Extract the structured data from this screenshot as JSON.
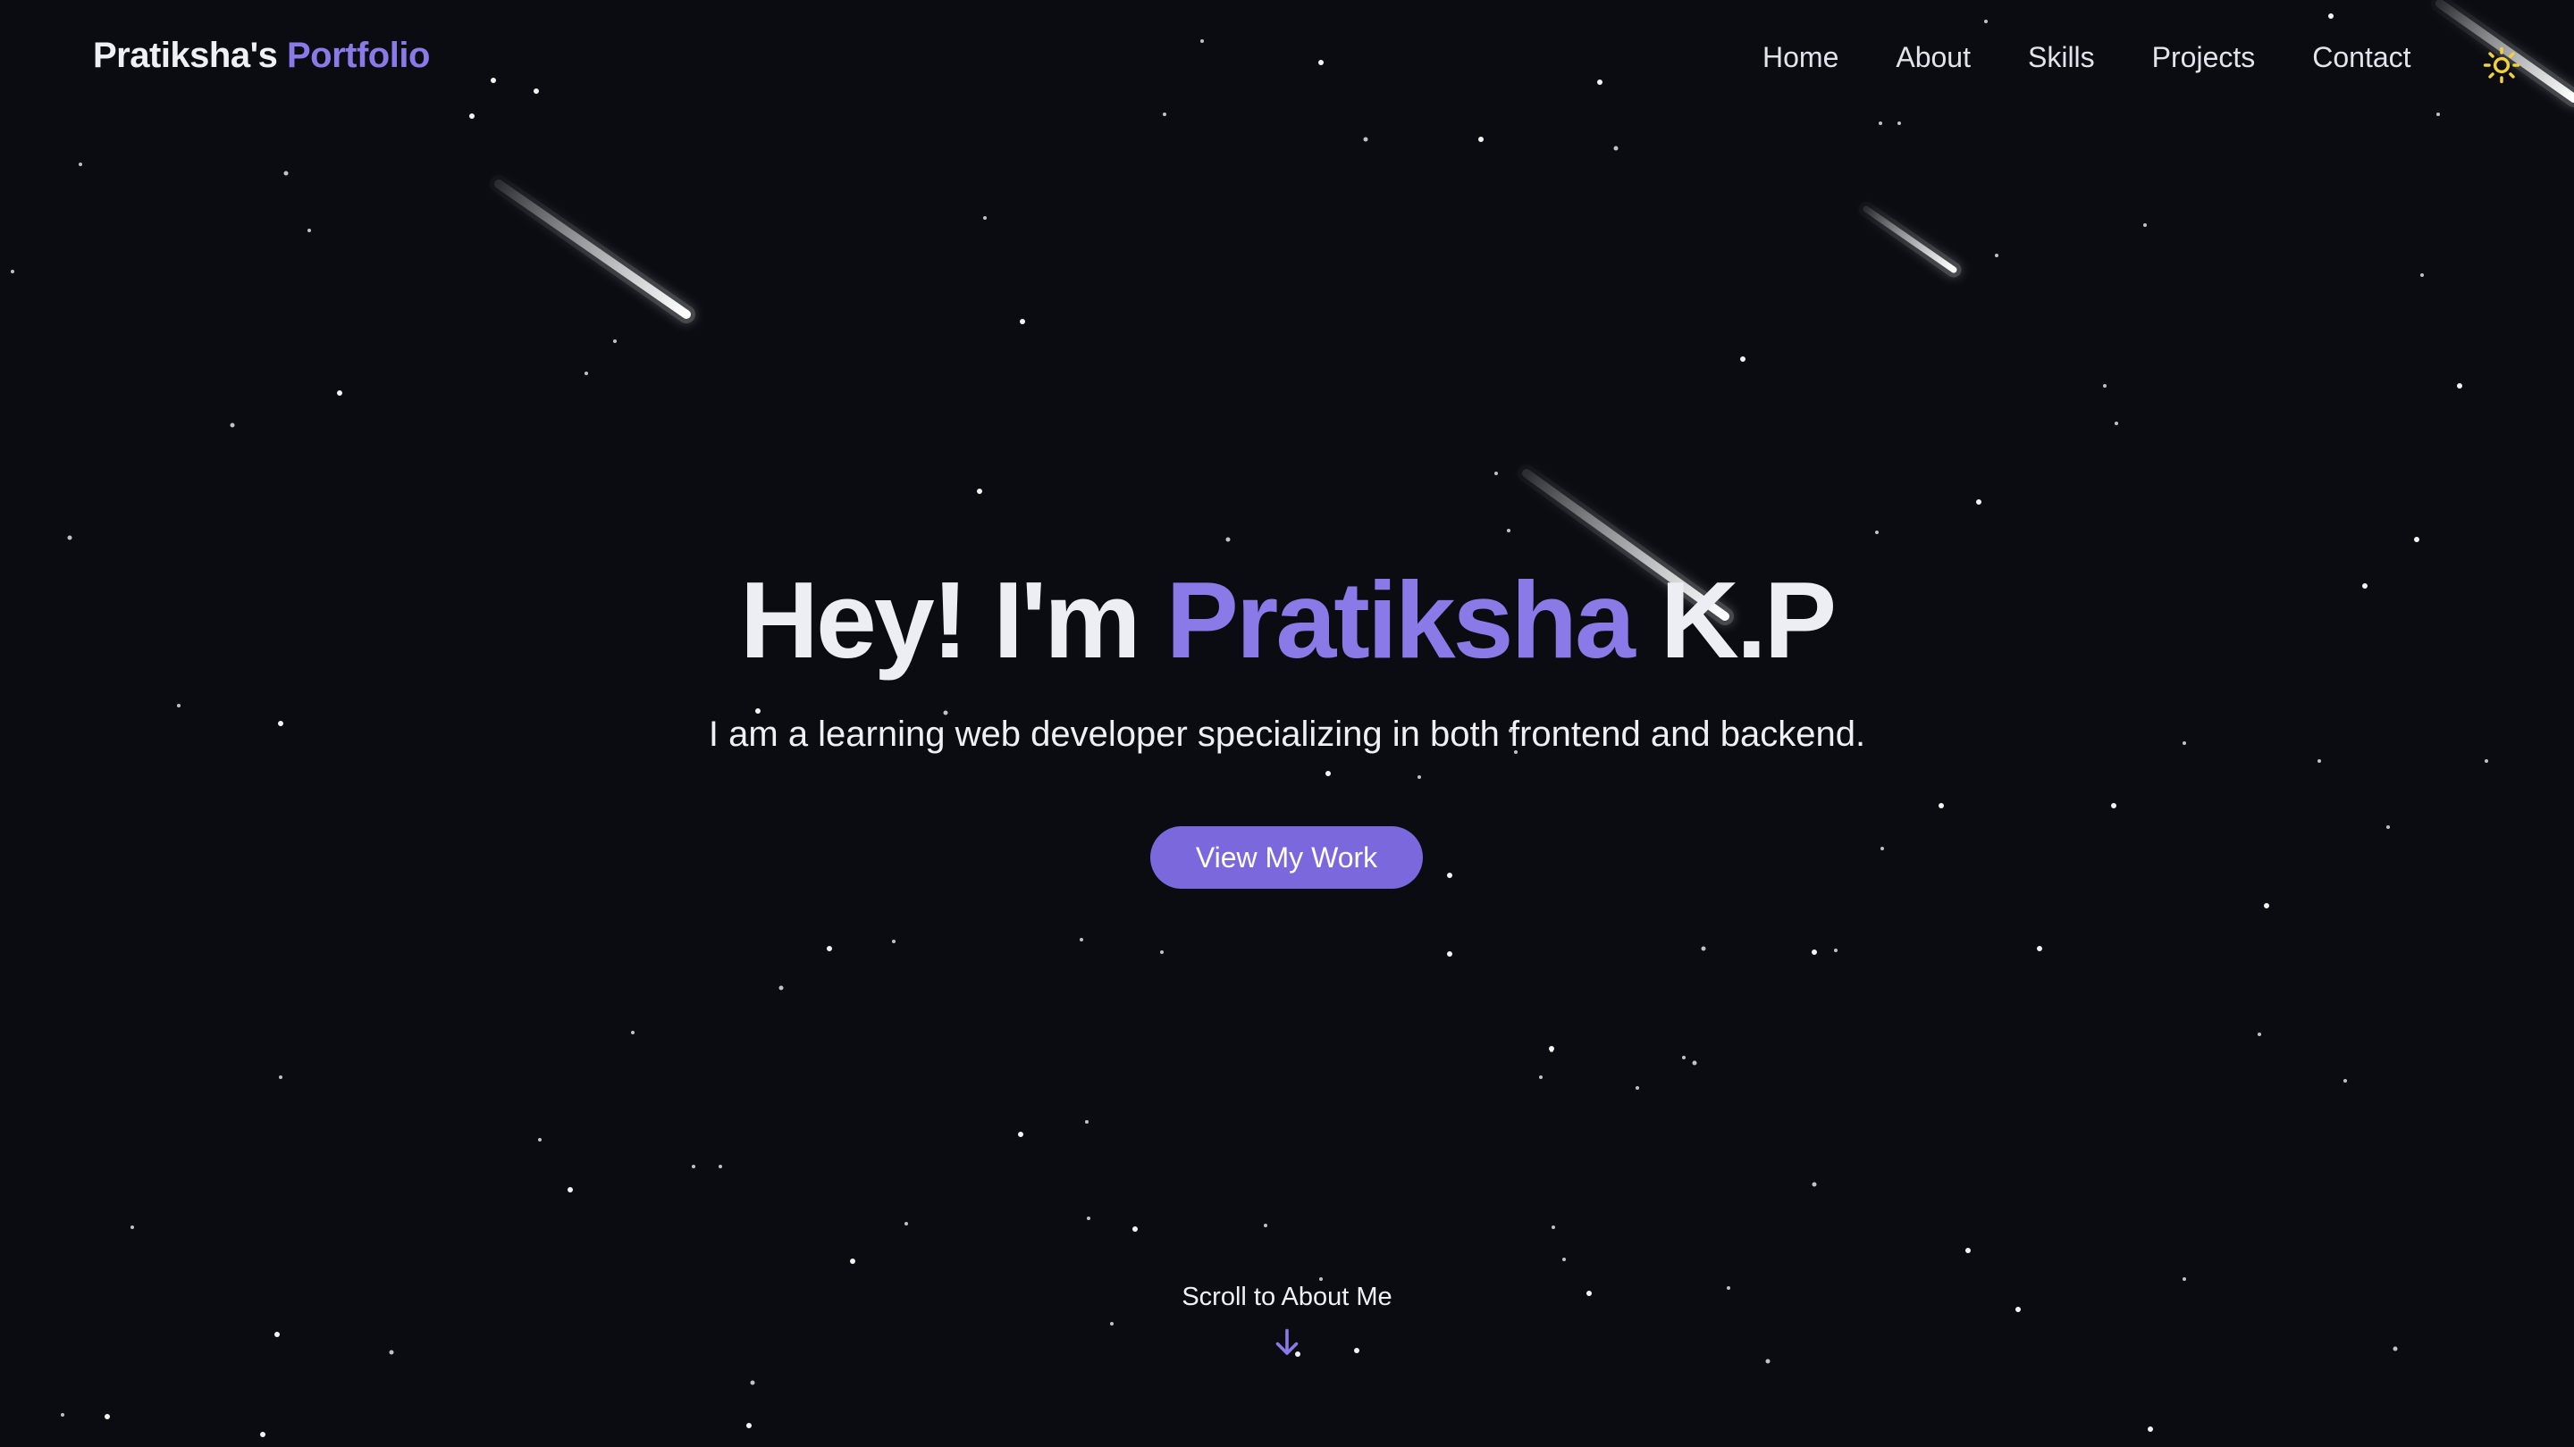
{
  "header": {
    "logo_name": "Pratiksha's",
    "logo_accent": "Portfolio"
  },
  "nav": {
    "items": [
      "Home",
      "About",
      "Skills",
      "Projects",
      "Contact"
    ],
    "theme_toggle_icon": "sun-icon"
  },
  "hero": {
    "greeting": "Hey! I'm",
    "name": "Pratiksha",
    "surname": "K.P",
    "subtitle": "I am a learning web developer specializing in both frontend and backend.",
    "cta_label": "View My Work"
  },
  "scroll": {
    "label": "Scroll to About Me",
    "icon": "arrow-down-icon"
  },
  "colors": {
    "background": "#0a0c12",
    "accent": "#8a7ae8",
    "button": "#7b68dd",
    "sun": "#f2d23c",
    "text": "#eceef3"
  }
}
